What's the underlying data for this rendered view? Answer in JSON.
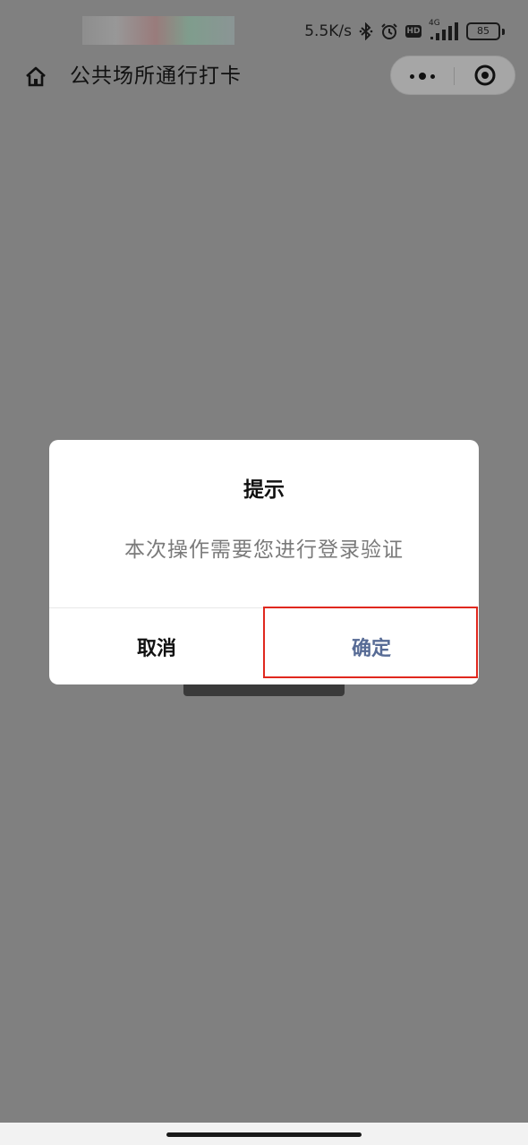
{
  "status_bar": {
    "net_speed": "5.5K/s",
    "network_type": "4G",
    "battery": "85",
    "hd_label": "HD",
    "icons": [
      "bluetooth-icon",
      "alarm-icon",
      "hd-icon",
      "signal-icon",
      "battery-icon"
    ]
  },
  "nav": {
    "title": "公共场所通行打卡",
    "home_icon": "home-icon",
    "more_icon": "more-icon",
    "close_icon": "target-close-icon"
  },
  "dialog": {
    "title": "提示",
    "message": "本次操作需要您进行登录验证",
    "cancel_label": "取消",
    "confirm_label": "确定"
  },
  "colors": {
    "overlay": "#808080",
    "confirm_text": "#576b95",
    "highlight_border": "#e0281e"
  }
}
